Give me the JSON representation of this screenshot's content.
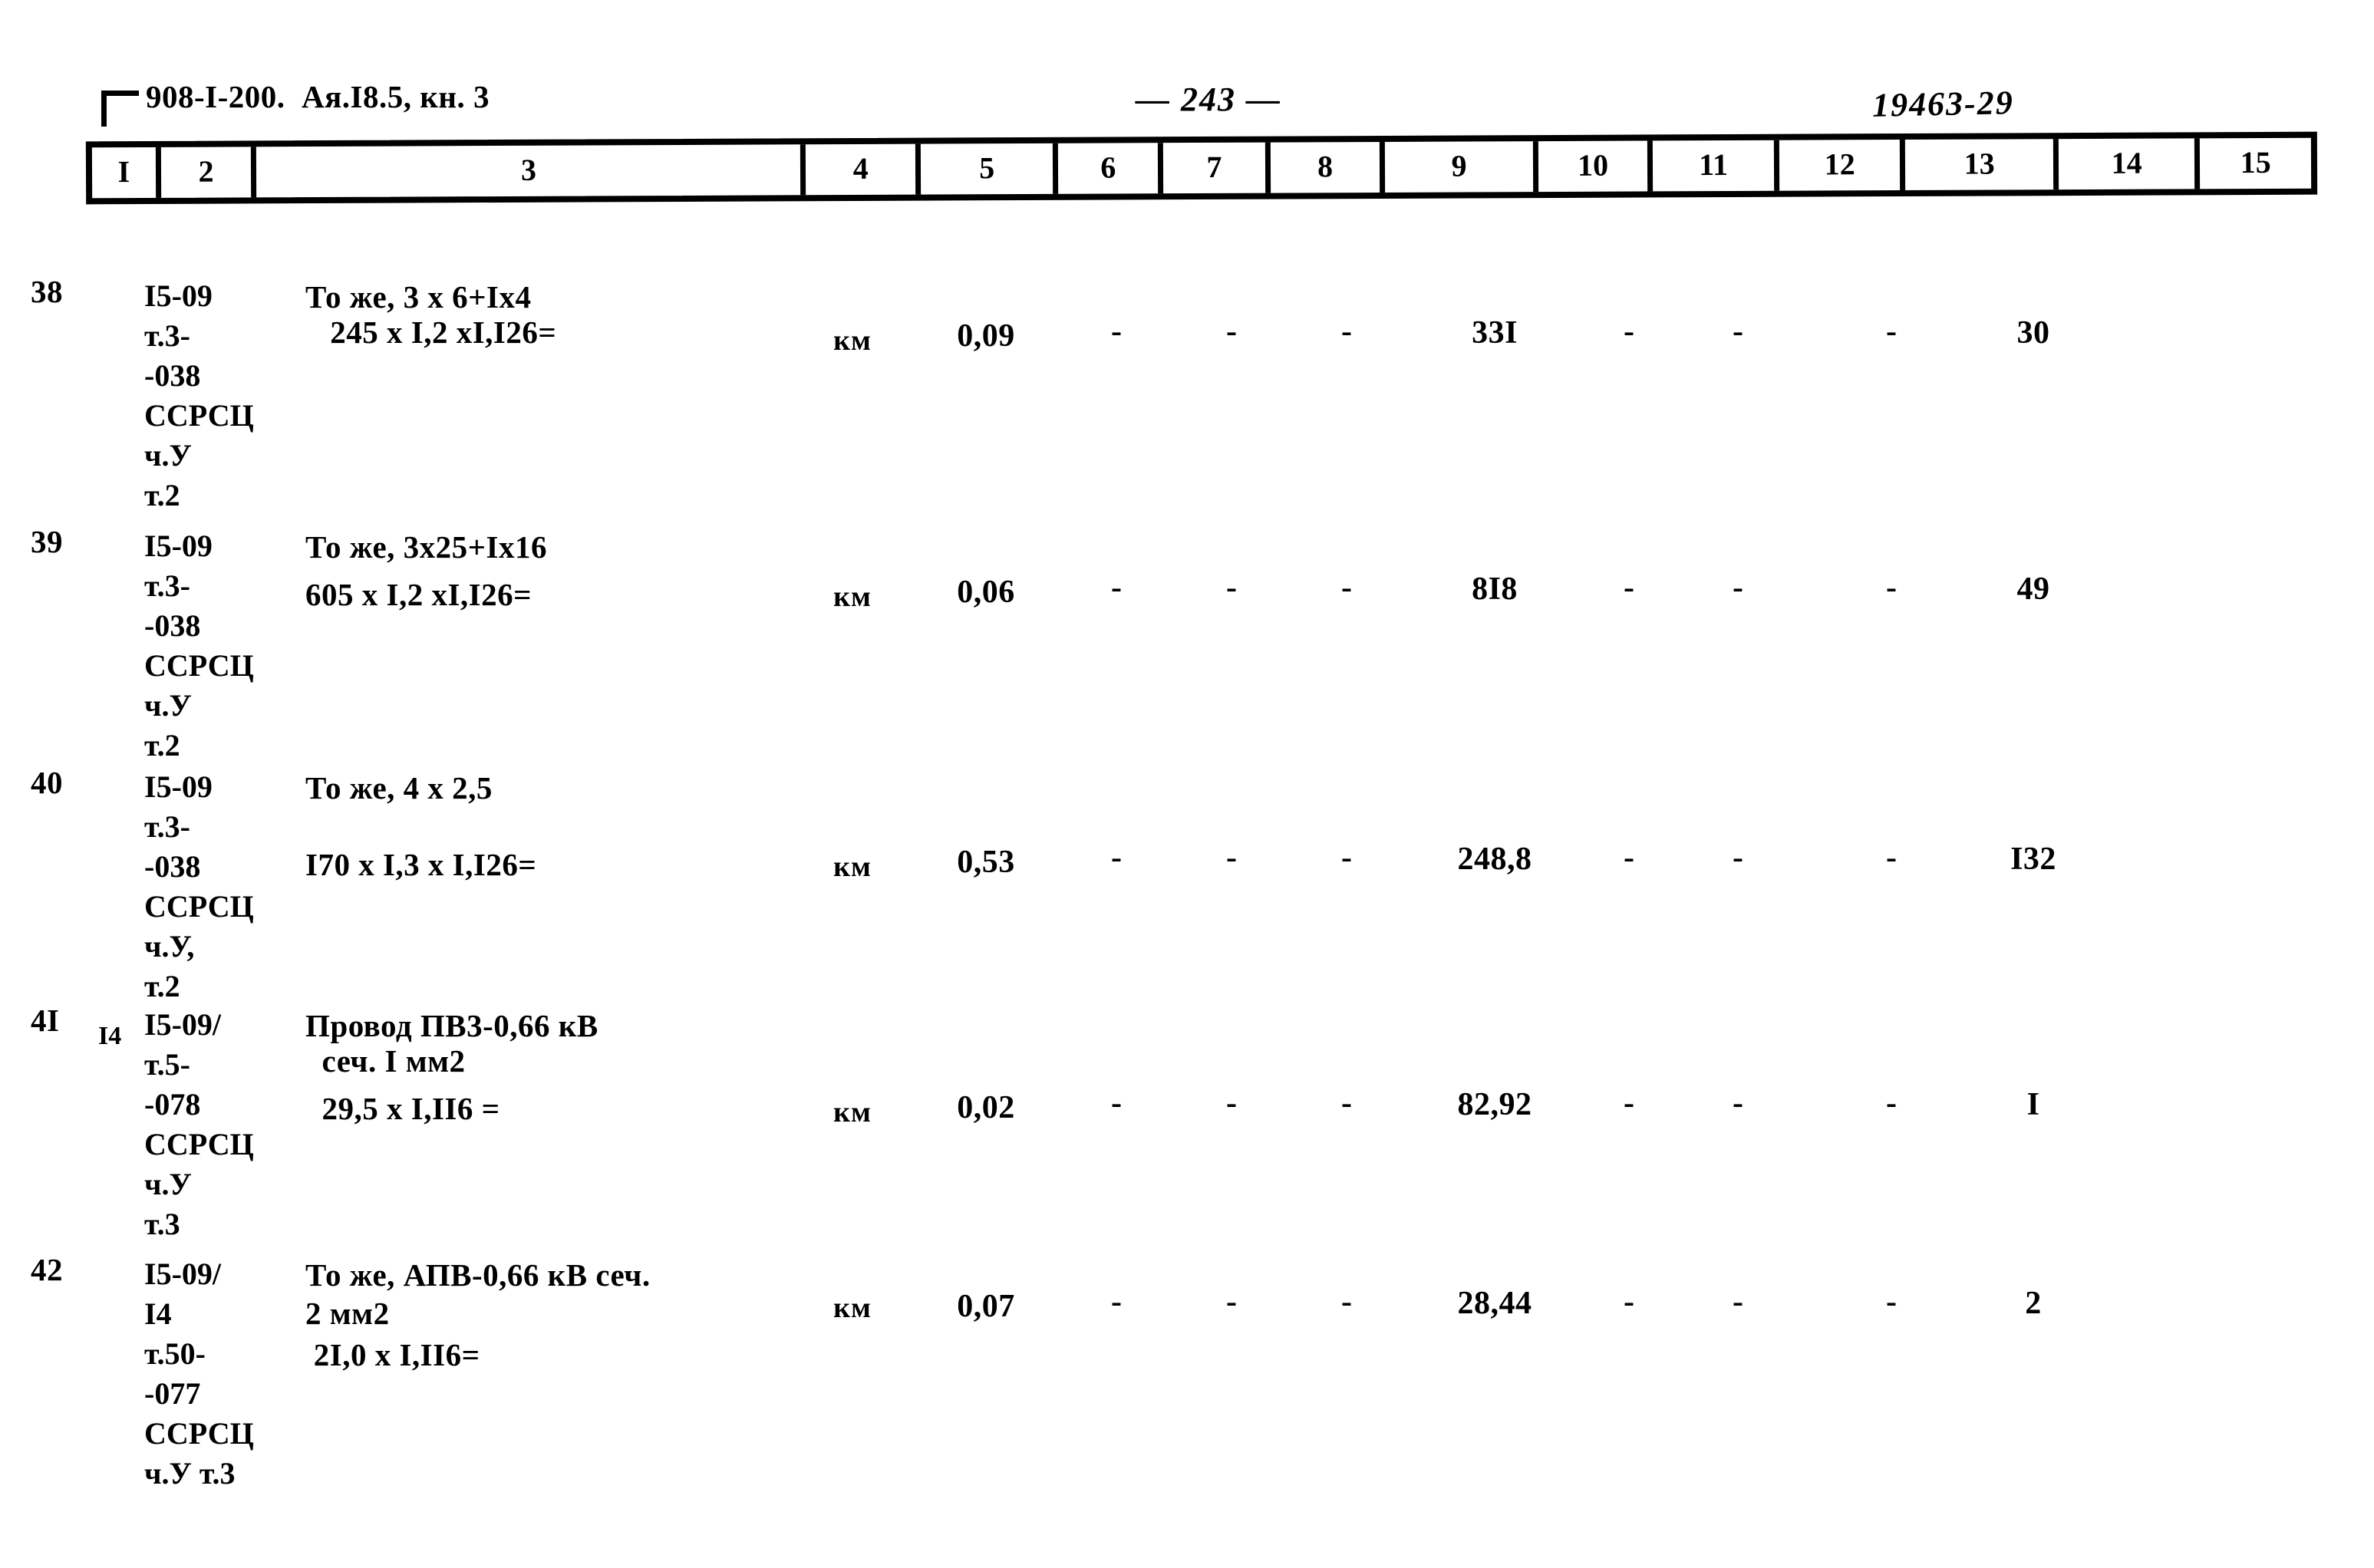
{
  "header": {
    "doc_code": "908-I-200.  Ая.I8.5, кн. 3",
    "page_number": "— 243 —",
    "archive_number": "19463-29",
    "corner_mark_icon": "corner-bracket-icon"
  },
  "table": {
    "column_headers": [
      "I",
      "2",
      "3",
      "4",
      "5",
      "6",
      "7",
      "8",
      "9",
      "10",
      "11",
      "12",
      "13",
      "14",
      "15"
    ],
    "rows": [
      {
        "num": "38",
        "code_line1": "I5-09",
        "code_rest": "т.3-\n-038\nССРСЦ\nч.У\nт.2",
        "code_sub": "",
        "desc_line1": "То же, 3 х 6+Iх4",
        "desc_line2": "   245 х I,2 хI,I26=",
        "desc_line3": "",
        "unit": "км",
        "col5": "0,09",
        "col6": "-",
        "col7": "-",
        "col8": "-",
        "col9": "33I",
        "col10": "-",
        "col11": "-",
        "col12": "-",
        "col13": "30",
        "col14": "",
        "col15": ""
      },
      {
        "num": "39",
        "code_line1": "I5-09",
        "code_rest": "т.3-\n-038\nССРСЦ\nч.У\nт.2",
        "code_sub": "",
        "desc_line1": "То же, 3х25+Iх16",
        "desc_line2": "605 х I,2 хI,I26=",
        "desc_line3": "",
        "unit": "км",
        "col5": "0,06",
        "col6": "-",
        "col7": "-",
        "col8": "-",
        "col9": "8I8",
        "col10": "-",
        "col11": "-",
        "col12": "-",
        "col13": "49",
        "col14": "",
        "col15": ""
      },
      {
        "num": "40",
        "code_line1": "I5-09",
        "code_rest": "т.3-\n-038\nССРСЦ\nч.У,\nт.2",
        "code_sub": "",
        "desc_line1": "То же, 4 х 2,5",
        "desc_line2": "I70 х I,3 х I,I26=",
        "desc_line3": "",
        "unit": "км",
        "col5": "0,53",
        "col6": "-",
        "col7": "-",
        "col8": "-",
        "col9": "248,8",
        "col10": "-",
        "col11": "-",
        "col12": "-",
        "col13": "I32",
        "col14": "",
        "col15": ""
      },
      {
        "num": "4I",
        "code_line1": "I5-09/",
        "code_rest": "т.5-\n-078\nССРСЦ\nч.У\nт.3",
        "code_sub": "I4",
        "desc_line1": "Провод ПВ3-0,66 кВ",
        "desc_line2": "  сеч. I мм2",
        "desc_line3": "  29,5 х I,II6 =",
        "unit": "км",
        "col5": "0,02",
        "col6": "-",
        "col7": "-",
        "col8": "-",
        "col9": "82,92",
        "col10": "-",
        "col11": "-",
        "col12": "-",
        "col13": "I",
        "col14": "",
        "col15": ""
      },
      {
        "num": "42",
        "code_line1": "I5-09/",
        "code_rest": "I4\nт.50-\n-077\nССРСЦ\nч.У т.3",
        "code_sub": "",
        "desc_line1": "То же, АПВ-0,66 кВ сеч.",
        "desc_line2": "2 мм2",
        "desc_line3": " 2I,0 х I,II6=",
        "unit": "км",
        "col5": "0,07",
        "col6": "-",
        "col7": "-",
        "col8": "-",
        "col9": "28,44",
        "col10": "-",
        "col11": "-",
        "col12": "-",
        "col13": "2",
        "col14": "",
        "col15": ""
      }
    ]
  }
}
